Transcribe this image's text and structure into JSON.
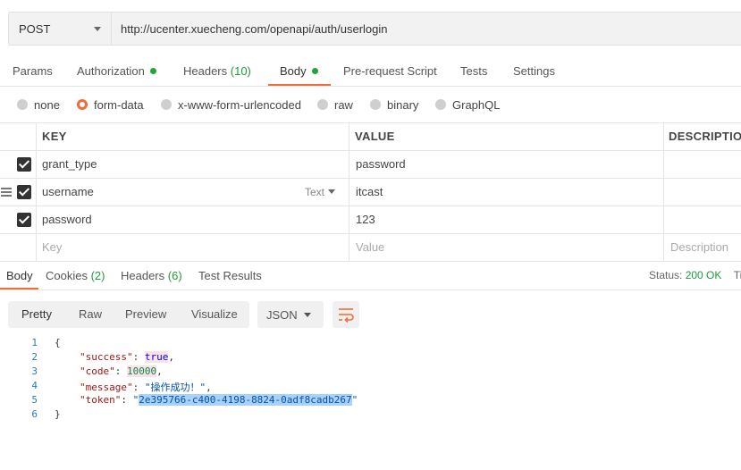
{
  "request": {
    "method": "POST",
    "url": "http://ucenter.xuecheng.com/openapi/auth/userlogin"
  },
  "tabs": [
    {
      "label": "Params"
    },
    {
      "label": "Authorization",
      "dot": true
    },
    {
      "label": "Headers",
      "count": "(10)"
    },
    {
      "label": "Body",
      "dot": true,
      "active": true
    },
    {
      "label": "Pre-request Script"
    },
    {
      "label": "Tests"
    },
    {
      "label": "Settings"
    }
  ],
  "body_types": {
    "none": "none",
    "form_data": "form-data",
    "urlencoded": "x-www-form-urlencoded",
    "raw": "raw",
    "binary": "binary",
    "graphql": "GraphQL",
    "selected": "form-data"
  },
  "table": {
    "headers": {
      "key": "KEY",
      "value": "VALUE",
      "description": "DESCRIPTION"
    },
    "rows": [
      {
        "key": "grant_type",
        "value": "password",
        "checked": true
      },
      {
        "key": "username",
        "value": "itcast",
        "checked": true,
        "type": "Text"
      },
      {
        "key": "password",
        "value": "123",
        "checked": true
      }
    ],
    "placeholders": {
      "key": "Key",
      "value": "Value",
      "description": "Description"
    }
  },
  "response_tabs": {
    "body": "Body",
    "cookies": "Cookies",
    "cookies_count": "(2)",
    "headers": "Headers",
    "headers_count": "(6)",
    "test_results": "Test Results"
  },
  "status": {
    "label": "Status:",
    "value": "200 OK",
    "time_label": "Ti"
  },
  "view_modes": {
    "pretty": "Pretty",
    "raw": "Raw",
    "preview": "Preview",
    "visualize": "Visualize"
  },
  "format": "JSON",
  "code": {
    "line_numbers": [
      "1",
      "2",
      "3",
      "4",
      "5",
      "6"
    ],
    "open_brace": "{",
    "close_brace": "}",
    "success_key": "\"success\"",
    "success_value": "true",
    "code_key": "\"code\"",
    "code_value": "10000",
    "message_key": "\"message\"",
    "message_value": "\"操作成功！\"",
    "token_key": "\"token\"",
    "token_quote_open": "\"",
    "token_value": "2e395766-c400-4198-8824-0adf8cadb267",
    "token_quote_close": "\""
  },
  "colors": {
    "accent": "#f26b3a",
    "green": "#1f9a3a"
  }
}
